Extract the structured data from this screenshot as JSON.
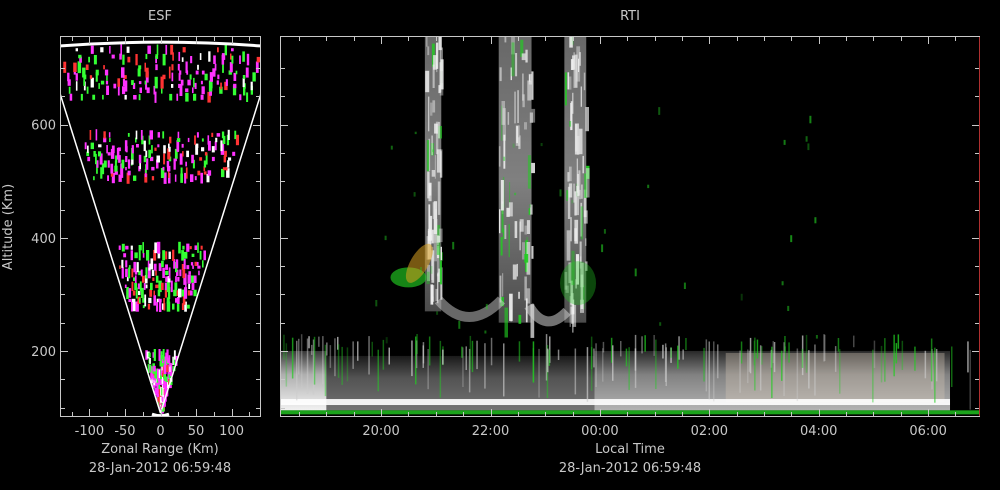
{
  "chart_data": [
    {
      "type": "scatter",
      "panel": "esf",
      "title": "ESF",
      "xlabel": "Zonal Range (Km)",
      "ylabel": "Altitude (Km)",
      "timestamp": "28-Jan-2012 06:59:48",
      "xlim": [
        -140,
        140
      ],
      "ylim": [
        85,
        755
      ],
      "xticks": [
        -100,
        -50,
        0,
        50,
        100
      ],
      "xtick_labels": [
        "-100",
        "-50",
        "0",
        "50",
        "100"
      ],
      "yticks": [
        200,
        400,
        600
      ],
      "ytick_labels": [
        "200",
        "400",
        "600"
      ],
      "beam_half_angle_deg": 10.5,
      "echo_layers": [
        {
          "alt_min": 645,
          "alt_max": 735,
          "intensity": 0.9
        },
        {
          "alt_min": 505,
          "alt_max": 585,
          "intensity": 0.85
        },
        {
          "alt_min": 275,
          "alt_max": 385,
          "intensity": 0.9
        },
        {
          "alt_min": 95,
          "alt_max": 195,
          "intensity": 0.8
        }
      ],
      "colors": {
        "echo": "#ff33ff",
        "echo2": "#33ff33",
        "echo3": "#ff3333",
        "echo4": "#ffffff",
        "beam": "#ffffff"
      }
    },
    {
      "type": "heatmap",
      "panel": "rti",
      "title": "RTI",
      "xlabel": "Local Time",
      "ylabel": "",
      "timestamp": "28-Jan-2012 06:59:48",
      "xlim": [
        18.17,
        30.93
      ],
      "ylim": [
        85,
        755
      ],
      "xticks": [
        20,
        22,
        24,
        26,
        28,
        30
      ],
      "xtick_labels": [
        "20:00",
        "22:00",
        "00:00",
        "02:00",
        "04:00",
        "06:00"
      ],
      "yticks": [
        200,
        400,
        600
      ],
      "plumes": [
        {
          "t_start": 20.8,
          "t_end": 21.1,
          "alt_min": 270,
          "alt_max": 755
        },
        {
          "t_start": 22.15,
          "t_end": 22.75,
          "alt_min": 250,
          "alt_max": 755
        },
        {
          "t_start": 23.35,
          "t_end": 23.75,
          "alt_min": 250,
          "alt_max": 755
        }
      ],
      "bottom_layer": {
        "alt_min": 95,
        "alt_max": 200
      },
      "colors": {
        "plume": "#dcdcdc",
        "green": "#22cc22",
        "warm": "#d8c8b8",
        "right_edge": "#b03030"
      }
    }
  ]
}
